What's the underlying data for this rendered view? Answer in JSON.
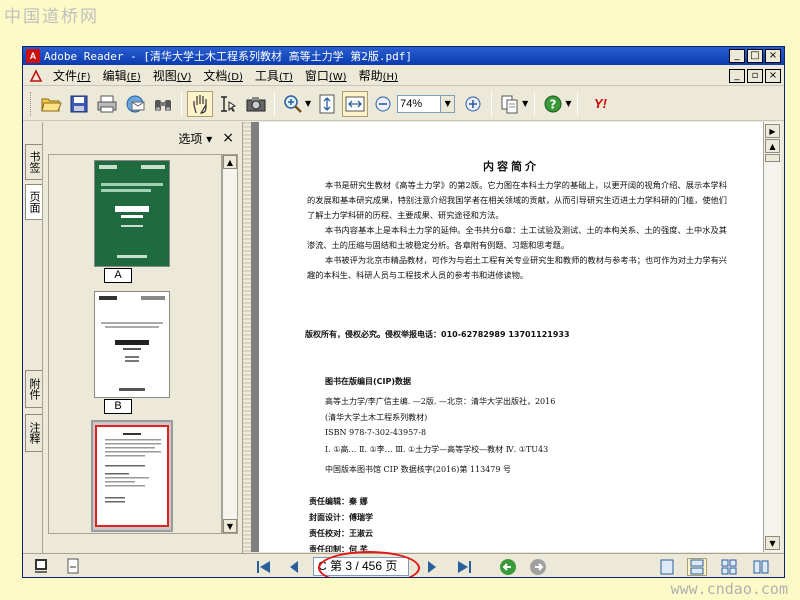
{
  "watermark_top": "中国道桥网",
  "watermark_bottom": "www.cndao.com",
  "window": {
    "title": "Adobe Reader - [清华大学土木工程系列教材  高等土力学  第2版.pdf]",
    "app_logo": "A",
    "controls": [
      "_",
      "□",
      "×"
    ],
    "mdi_controls": [
      "_",
      "▫",
      "×"
    ]
  },
  "menu": {
    "items": [
      {
        "label": "文件",
        "acc": "(F)"
      },
      {
        "label": "编辑",
        "acc": "(E)"
      },
      {
        "label": "视图",
        "acc": "(V)"
      },
      {
        "label": "文档",
        "acc": "(D)"
      },
      {
        "label": "工具",
        "acc": "(T)"
      },
      {
        "label": "窗口",
        "acc": "(W)"
      },
      {
        "label": "帮助",
        "acc": "(H)"
      }
    ]
  },
  "toolbar": {
    "zoom_value": "74%",
    "yahoo_label": "Y!"
  },
  "side_tabs": [
    "书签",
    "页面",
    "附件",
    "注释"
  ],
  "panel": {
    "options_label": "选项 ▾",
    "close_label": "×",
    "thumb_labels": [
      "A",
      "B"
    ]
  },
  "page": {
    "title": "内容简介",
    "paragraphs": [
      "本书是研究生教材《高等土力学》的第2版。它力图在本科土力学的基础上，以更开阔的视角介绍、展示本学科的发展和基本研究成果，特别注意介绍我国学者在相关领域的贡献，从而引导研究生迈进土力学科研的门槛，使他们了解土力学科研的历程、主要成果、研究途径和方法。",
      "本书内容基本上是本科土力学的延伸。全书共分6章：土工试验及测试、土的本构关系、土的强度、土中水及其渗流、土的压缩与固结和土坡稳定分析。各章附有例题、习题和思考题。",
      "本书被评为北京市精品教材，可作为与岩土工程有关专业研究生和教师的教材与参考书；也可作为对土力学有兴趣的本科生、科研人员与工程技术人员的参考书和进修读物。"
    ],
    "copyright": "版权所有，侵权必究。侵权举报电话：010-62782989   13701121933",
    "cip_heading": "图书在版编目(CIP)数据",
    "cip_lines": [
      "高等土力学/李广信主编. —2版. —北京：清华大学出版社，2016",
      "(清华大学土木工程系列教材)",
      "ISBN 978-7-302-43957-8",
      "Ⅰ. ①高…   Ⅱ. ①李…   Ⅲ. ①土力学—高等学校—教材   Ⅳ. ①TU43",
      "中国版本图书馆 CIP 数据核字(2016)第 113479 号"
    ],
    "credits": [
      "责任编辑：秦   娜",
      "封面设计：傅瑞学",
      "责任校对：王淑云",
      "责任印制：何   芊"
    ]
  },
  "status": {
    "page_indicator": "C 第 3 / 456 页"
  }
}
